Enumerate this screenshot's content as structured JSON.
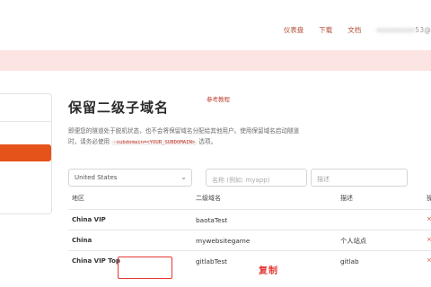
{
  "topnav": {
    "dashboard": "仪表盘",
    "download": "下载",
    "docs": "文档",
    "email_hidden": "ooooooooo",
    "email_suffix": "53@"
  },
  "page": {
    "title": "保留二级子域名",
    "ref_link": "参考教程",
    "desc_line1": "即便您的隧道处于脱机状态，也不会将保留域名分配给其他用户。使用保留域名启动隧道",
    "desc_line2_pre": "时，请务必使用",
    "desc_code": "-subdomain=<YOUR_SUBDOMAIN>",
    "desc_line2_post": "选项。"
  },
  "form": {
    "region_selected": "United States",
    "subdomain_placeholder": "名称 (例如: myapp)",
    "note_placeholder": "描述"
  },
  "table": {
    "headers": [
      "地区",
      "二级域名",
      "描述",
      "操"
    ],
    "rows": [
      {
        "region": "China VIP",
        "subdomain": "baotaTest",
        "note": "",
        "mark": "×"
      },
      {
        "region": "China",
        "subdomain": "mywebsitegame",
        "note": "个人站点",
        "mark": "×"
      },
      {
        "region": "China VIP Top",
        "subdomain": "gitlabTest",
        "note": "gitlab",
        "mark": "×"
      }
    ]
  },
  "annotation": {
    "copy_label": "复制"
  },
  "colors": {
    "accent": "#e5531a",
    "nav_link": "#b0503a",
    "alert_bg": "#fbe4e2",
    "annotation_red": "#e53935"
  }
}
